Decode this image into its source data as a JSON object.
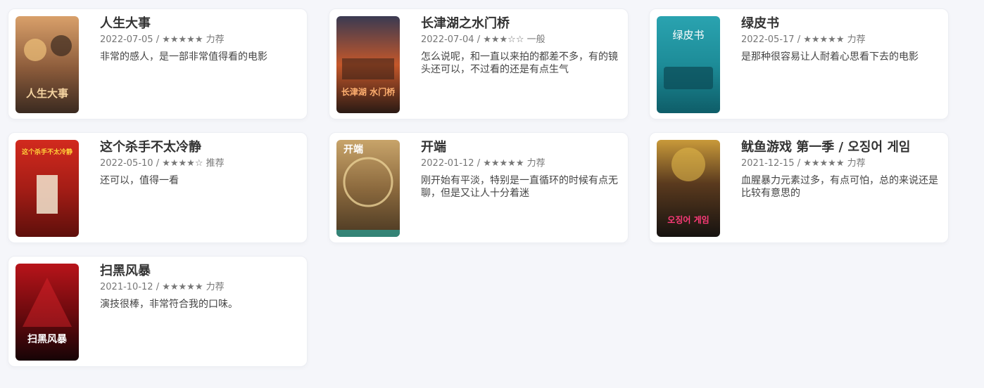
{
  "movies": [
    {
      "title": "人生大事",
      "date": "2022-07-05",
      "stars": "★★★★★",
      "rating_label": "力荐",
      "comment": "非常的感人，是一部非常值得看的电影",
      "poster_text": "人生大事",
      "colors": {
        "top": "#d9a06a",
        "mid": "#8a5a3a",
        "bottom": "#3a2a20",
        "accent": "#f4d3a0"
      }
    },
    {
      "title": "长津湖之水门桥",
      "date": "2022-07-04",
      "stars": "★★★☆☆",
      "rating_label": "一般",
      "comment": "怎么说呢，和一直以来拍的都差不多，有的镜头还可以，不过看的还是有点生气",
      "poster_text": "长津湖 水门桥",
      "colors": {
        "top": "#3a3a52",
        "mid": "#c4572a",
        "bottom": "#2a1a14",
        "accent": "#ffb070"
      }
    },
    {
      "title": "绿皮书",
      "date": "2022-05-17",
      "stars": "★★★★★",
      "rating_label": "力荐",
      "comment": "是那种很容易让人耐着心思看下去的电影",
      "poster_text": "绿皮书",
      "colors": {
        "top": "#2aa3b0",
        "mid": "#1d8c98",
        "bottom": "#0e5d68",
        "accent": "#ffffff"
      }
    },
    {
      "title": "这个杀手不太冷静",
      "date": "2022-05-10",
      "stars": "★★★★☆",
      "rating_label": "推荐",
      "comment": "还可以，值得一看",
      "poster_text": "这个杀手不太冷静",
      "colors": {
        "top": "#d22a1e",
        "mid": "#a51d16",
        "bottom": "#5e0f0b",
        "accent": "#ffd23a"
      }
    },
    {
      "title": "开端",
      "date": "2022-01-12",
      "stars": "★★★★★",
      "rating_label": "力荐",
      "comment": "刚开始有平淡，特别是一直循环的时候有点无聊，但是又让人十分着迷",
      "poster_text": "开端",
      "colors": {
        "top": "#c8a46a",
        "mid": "#8c6a3e",
        "bottom": "#4a3822",
        "accent": "#2aa39a"
      }
    },
    {
      "title": "鱿鱼游戏 第一季 / 오징어 게임",
      "date": "2021-12-15",
      "stars": "★★★★★",
      "rating_label": "力荐",
      "comment": "血腥暴力元素过多，有点可怕，总的来说还是比较有意思的",
      "poster_text": "오징어 게임",
      "colors": {
        "top": "#c99a3a",
        "mid": "#5a3a1e",
        "bottom": "#161210",
        "accent": "#ff3a7a"
      }
    },
    {
      "title": "扫黑风暴",
      "date": "2021-10-12",
      "stars": "★★★★★",
      "rating_label": "力荐",
      "comment": "演技很棒，非常符合我的口味。",
      "poster_text": "扫黑风暴",
      "colors": {
        "top": "#b8141a",
        "mid": "#6e0a0e",
        "bottom": "#160406",
        "accent": "#ffffff"
      }
    }
  ]
}
